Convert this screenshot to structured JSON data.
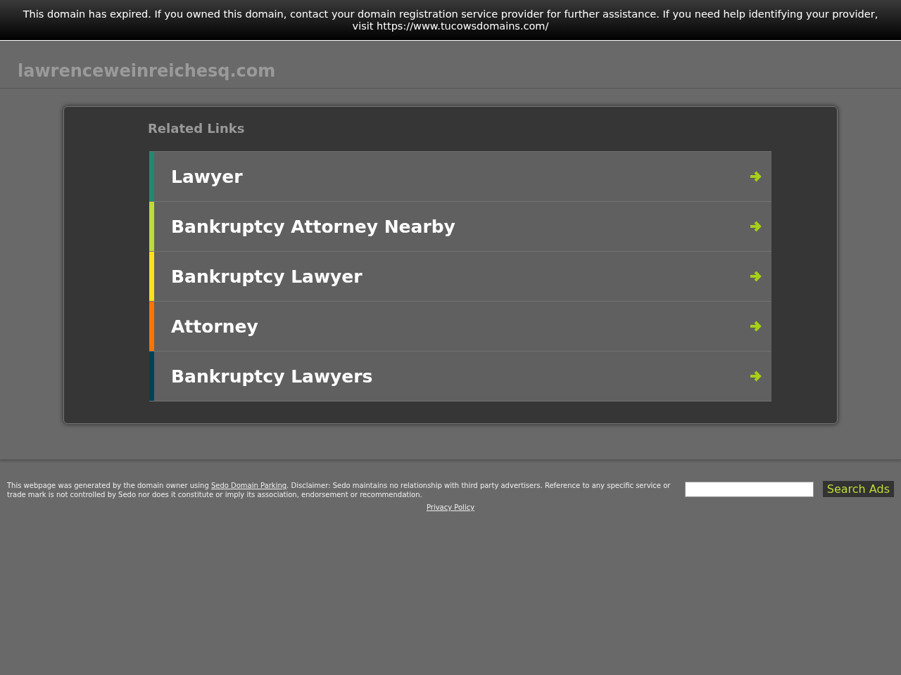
{
  "banner": {
    "text": "This domain has expired. If you owned this domain, contact your domain registration service provider for further assistance. If you need help identifying your provider, visit https://www.tucowsdomains.com/"
  },
  "header": {
    "domain": "lawrenceweinreichesq.com"
  },
  "related": {
    "title": "Related Links",
    "links": [
      {
        "label": "Lawyer",
        "color": "#1f8a70"
      },
      {
        "label": "Bankruptcy Attorney Nearby",
        "color": "#bedb39"
      },
      {
        "label": "Bankruptcy Lawyer",
        "color": "#ffe11a"
      },
      {
        "label": "Attorney",
        "color": "#fd7400"
      },
      {
        "label": "Bankruptcy Lawyers",
        "color": "#004358"
      }
    ]
  },
  "footer": {
    "disclaimer_before": "This webpage was generated by the domain owner using",
    "disclaimer_link": "Sedo Domain Parking",
    "disclaimer_after": ". Disclaimer: Sedo maintains no relationship with third party advertisers. Reference to any specific service or trade mark is not controlled by Sedo nor does it constitute or imply its association, endorsement or recommendation.",
    "privacy": "Privacy Policy",
    "search_button": "Search Ads"
  }
}
